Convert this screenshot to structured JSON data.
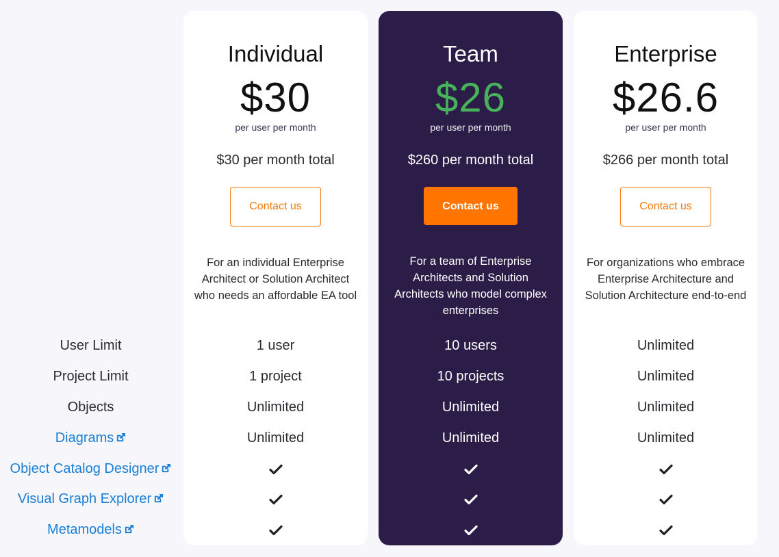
{
  "features": [
    {
      "label": "User Limit",
      "link": false
    },
    {
      "label": "Project Limit",
      "link": false
    },
    {
      "label": "Objects",
      "link": false
    },
    {
      "label": "Diagrams",
      "link": true,
      "icon": "external-link-icon"
    },
    {
      "label": "Object Catalog Designer",
      "link": true,
      "icon": "external-link-icon"
    },
    {
      "label": "Visual Graph Explorer",
      "link": true,
      "icon": "external-link-icon"
    },
    {
      "label": "Metamodels",
      "link": true,
      "icon": "external-link-icon"
    }
  ],
  "plans": [
    {
      "name": "Individual",
      "price": "$30",
      "per": "per user per month",
      "total": "$30 per month total",
      "cta": "Contact us",
      "description": "For an individual Enterprise Architect or Solution Architect who needs an affordable EA tool",
      "values": [
        "1 user",
        "1 project",
        "Unlimited",
        "Unlimited",
        "check",
        "check",
        "check"
      ]
    },
    {
      "name": "Team",
      "price": "$26",
      "per": "per user per month",
      "total": "$260 per month total",
      "cta": "Contact us",
      "featured": true,
      "description": "For a team of Enterprise Architects and Solution Architects who model complex enterprises",
      "values": [
        "10 users",
        "10 projects",
        "Unlimited",
        "Unlimited",
        "check",
        "check",
        "check"
      ]
    },
    {
      "name": "Enterprise",
      "price": "$26.6",
      "per": "per user per month",
      "total": "$266 per month total",
      "cta": "Contact us",
      "description": "For organizations who embrace Enterprise Architecture and Solution Architecture end-to-end",
      "values": [
        "Unlimited",
        "Unlimited",
        "Unlimited",
        "Unlimited",
        "check",
        "check",
        "check"
      ]
    }
  ],
  "colors": {
    "background": "#f6f6fb",
    "featured_card": "#2b1d48",
    "featured_price": "#47b25a",
    "accent_orange": "#ff7500",
    "link_blue": "#1a7fd6"
  }
}
